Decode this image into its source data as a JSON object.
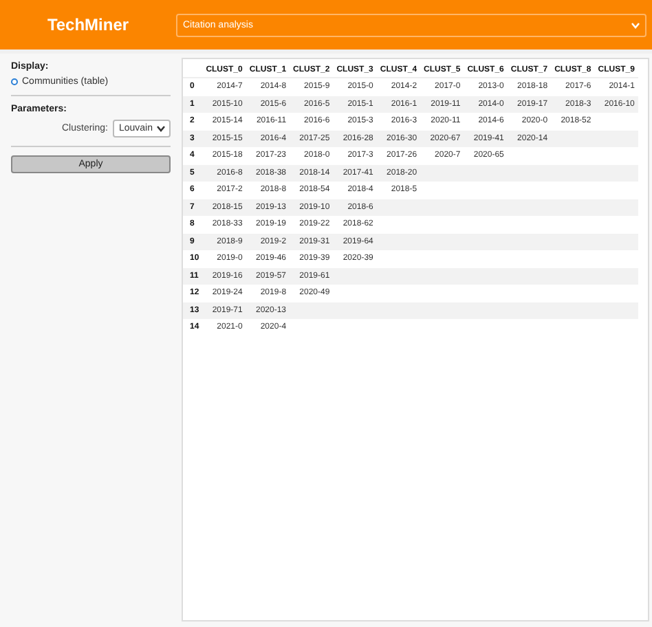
{
  "header": {
    "title": "TechMiner",
    "analysis_select": {
      "value": "Citation analysis"
    }
  },
  "sidebar": {
    "display_label": "Display:",
    "display_options": [
      {
        "label": "Communities (table)",
        "selected": true
      }
    ],
    "parameters_label": "Parameters:",
    "clustering": {
      "label": "Clustering:",
      "value": "Louvain"
    },
    "apply_button": "Apply"
  },
  "table": {
    "columns": [
      "CLUST_0",
      "CLUST_1",
      "CLUST_2",
      "CLUST_3",
      "CLUST_4",
      "CLUST_5",
      "CLUST_6",
      "CLUST_7",
      "CLUST_8",
      "CLUST_9"
    ],
    "rows": [
      {
        "index": "0",
        "cells": [
          "2014-7",
          "2014-8",
          "2015-9",
          "2015-0",
          "2014-2",
          "2017-0",
          "2013-0",
          "2018-18",
          "2017-6",
          "2014-1"
        ]
      },
      {
        "index": "1",
        "cells": [
          "2015-10",
          "2015-6",
          "2016-5",
          "2015-1",
          "2016-1",
          "2019-11",
          "2014-0",
          "2019-17",
          "2018-3",
          "2016-10"
        ]
      },
      {
        "index": "2",
        "cells": [
          "2015-14",
          "2016-11",
          "2016-6",
          "2015-3",
          "2016-3",
          "2020-11",
          "2014-6",
          "2020-0",
          "2018-52"
        ]
      },
      {
        "index": "3",
        "cells": [
          "2015-15",
          "2016-4",
          "2017-25",
          "2016-28",
          "2016-30",
          "2020-67",
          "2019-41",
          "2020-14"
        ]
      },
      {
        "index": "4",
        "cells": [
          "2015-18",
          "2017-23",
          "2018-0",
          "2017-3",
          "2017-26",
          "2020-7",
          "2020-65"
        ]
      },
      {
        "index": "5",
        "cells": [
          "2016-8",
          "2018-38",
          "2018-14",
          "2017-41",
          "2018-20"
        ]
      },
      {
        "index": "6",
        "cells": [
          "2017-2",
          "2018-8",
          "2018-54",
          "2018-4",
          "2018-5"
        ]
      },
      {
        "index": "7",
        "cells": [
          "2018-15",
          "2019-13",
          "2019-10",
          "2018-6"
        ]
      },
      {
        "index": "8",
        "cells": [
          "2018-33",
          "2019-19",
          "2019-22",
          "2018-62"
        ]
      },
      {
        "index": "9",
        "cells": [
          "2018-9",
          "2019-2",
          "2019-31",
          "2019-64"
        ]
      },
      {
        "index": "10",
        "cells": [
          "2019-0",
          "2019-46",
          "2019-39",
          "2020-39"
        ]
      },
      {
        "index": "11",
        "cells": [
          "2019-16",
          "2019-57",
          "2019-61"
        ]
      },
      {
        "index": "12",
        "cells": [
          "2019-24",
          "2019-8",
          "2020-49"
        ]
      },
      {
        "index": "13",
        "cells": [
          "2019-71",
          "2020-13"
        ]
      },
      {
        "index": "14",
        "cells": [
          "2021-0",
          "2020-4"
        ]
      }
    ]
  }
}
